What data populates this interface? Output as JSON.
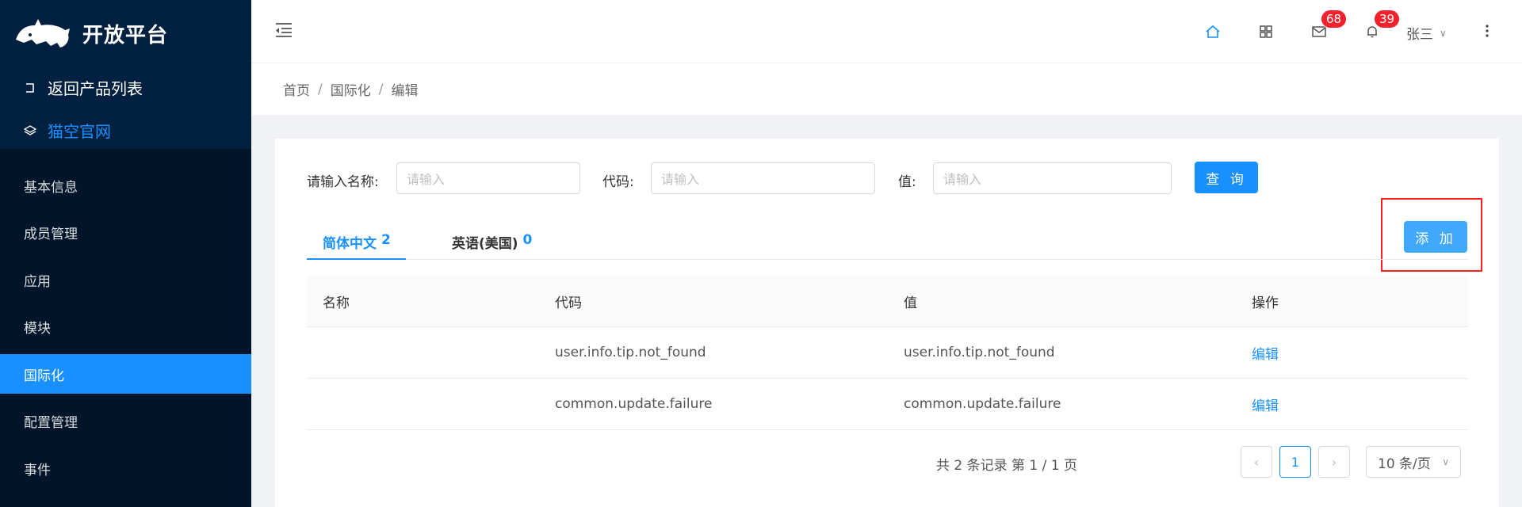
{
  "sidebar": {
    "logo_text": "开放平台",
    "back_label": "返回产品列表",
    "site_label": "猫空官网",
    "menu": [
      {
        "label": "基本信息"
      },
      {
        "label": "成员管理"
      },
      {
        "label": "应用"
      },
      {
        "label": "模块"
      },
      {
        "label": "国际化"
      },
      {
        "label": "配置管理"
      },
      {
        "label": "事件"
      }
    ]
  },
  "header": {
    "mail_badge": "68",
    "bell_badge": "39",
    "user_name": "张三"
  },
  "breadcrumb": [
    "首页",
    "国际化",
    "编辑"
  ],
  "filters": {
    "name_label": "请输入名称:",
    "name_placeholder": "请输入",
    "code_label": "代码:",
    "code_placeholder": "请输入",
    "value_label": "值:",
    "value_placeholder": "请输入",
    "query_button": "查 询",
    "add_button": "添 加"
  },
  "tabs": [
    {
      "label": "简体中文",
      "count": "2"
    },
    {
      "label": "英语(美国)",
      "count": "0"
    }
  ],
  "table": {
    "headers": [
      "名称",
      "代码",
      "值",
      "操作"
    ],
    "rows": [
      {
        "name": "",
        "code": "user.info.tip.not_found",
        "value": "user.info.tip.not_found",
        "action": "编辑"
      },
      {
        "name": "",
        "code": "common.update.failure",
        "value": "common.update.failure",
        "action": "编辑"
      }
    ]
  },
  "pagination": {
    "total_text": "共 2 条记录 第 1 / 1 页",
    "prev": "‹",
    "current": "1",
    "next": "›",
    "page_size": "10 条/页"
  },
  "colors": {
    "primary": "#1890ff",
    "sidebar_bg": "#001529",
    "badge": "#f5222d",
    "highlight": "#ff1f1f"
  }
}
